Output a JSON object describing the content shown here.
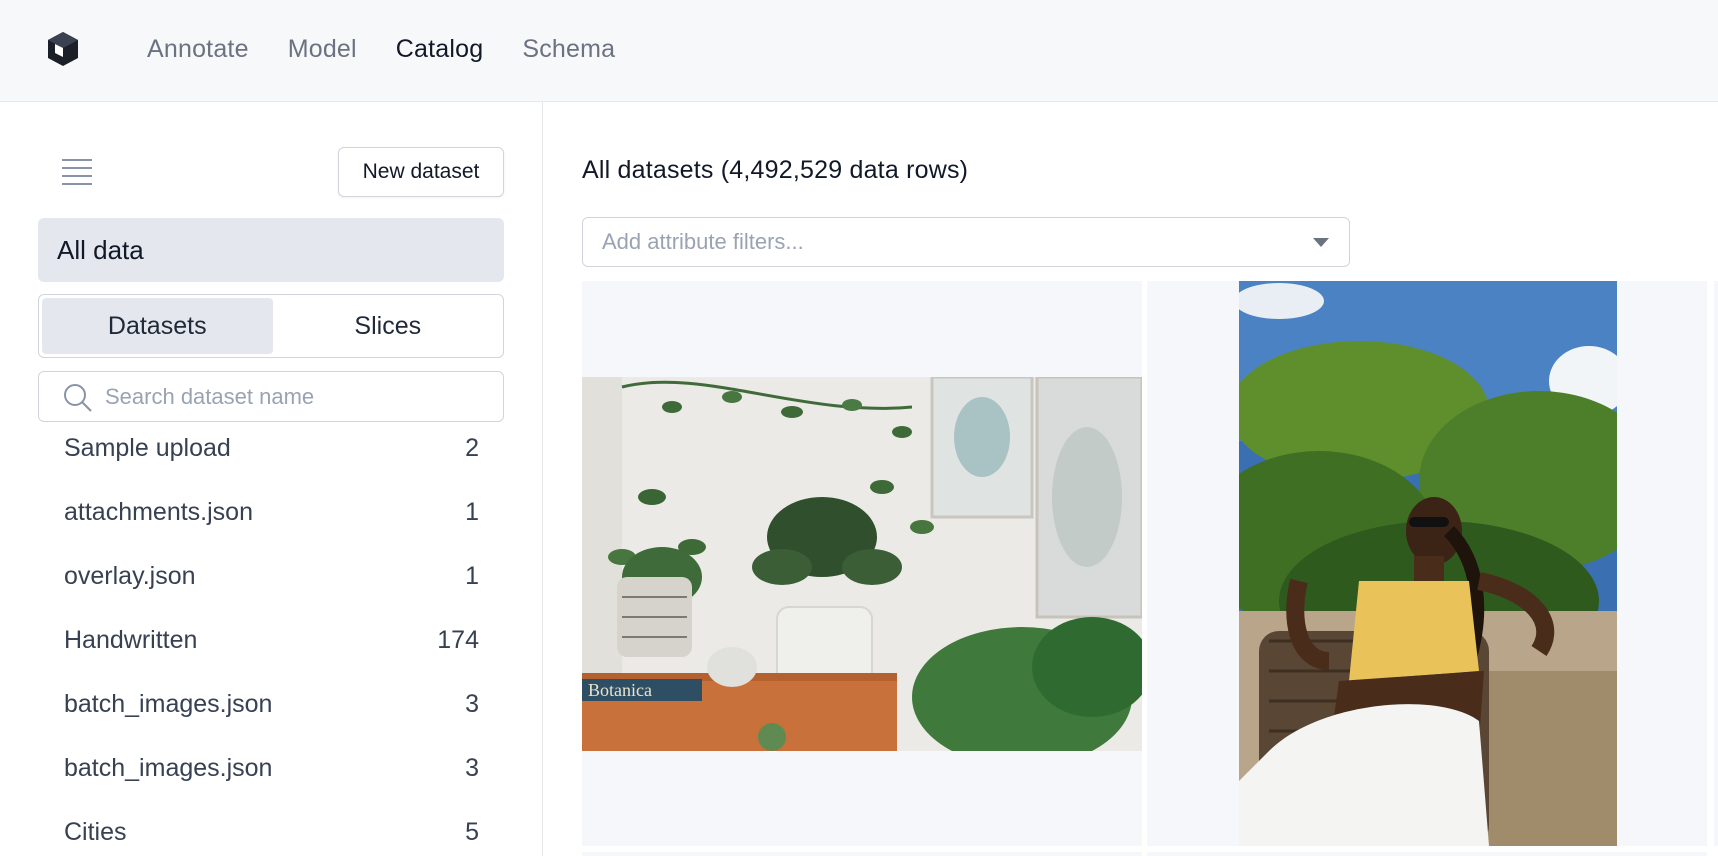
{
  "header": {
    "nav": [
      {
        "label": "Annotate",
        "active": false
      },
      {
        "label": "Model",
        "active": false
      },
      {
        "label": "Catalog",
        "active": true
      },
      {
        "label": "Schema",
        "active": false
      }
    ]
  },
  "sidebar": {
    "new_dataset_label": "New dataset",
    "all_data_label": "All data",
    "tabs": [
      {
        "label": "Datasets",
        "active": true
      },
      {
        "label": "Slices",
        "active": false
      }
    ],
    "search": {
      "placeholder": "Search dataset name",
      "value": ""
    },
    "datasets": [
      {
        "name": "Sample upload",
        "count": "2"
      },
      {
        "name": "attachments.json",
        "count": "1"
      },
      {
        "name": "overlay.json",
        "count": "1"
      },
      {
        "name": "Handwritten",
        "count": "174"
      },
      {
        "name": "batch_images.json",
        "count": "3"
      },
      {
        "name": "batch_images.json",
        "count": "3"
      },
      {
        "name": "Cities",
        "count": "5"
      }
    ]
  },
  "main": {
    "title": "All datasets (4,492,529 data rows)",
    "filter_placeholder": "Add attribute filters..."
  },
  "colors": {
    "topbar_bg": "#f7f8fa",
    "selected_bg": "#e4e8ee",
    "placeholder": "#9aa3b2",
    "tile_bg": "#f6f7fa"
  },
  "icons": [
    "logo-icon",
    "menu-icon",
    "search-icon",
    "caret-down-icon"
  ]
}
